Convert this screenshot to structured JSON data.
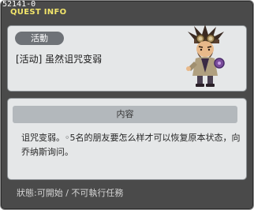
{
  "quest_id": "52141-0",
  "panel_title": "QUEST INFO",
  "category": "活動",
  "quest_title": "[活动] 虽然诅咒变弱",
  "npc": {
    "icon": "goggles-npc-portrait"
  },
  "section_header": "内容",
  "description": "诅咒变弱。◦5名的朋友要怎么样才可以恢复原本状态，向乔纳斯询问。",
  "status": "狀態:可開始 / 不可執行任務",
  "colors": {
    "panel_bg": "#4a4a4a",
    "title_yellow": "#f2e56a",
    "box_bg": "#e5e7e8",
    "tag_bg": "#6e7277",
    "header_bg": "#b3b8bc"
  }
}
